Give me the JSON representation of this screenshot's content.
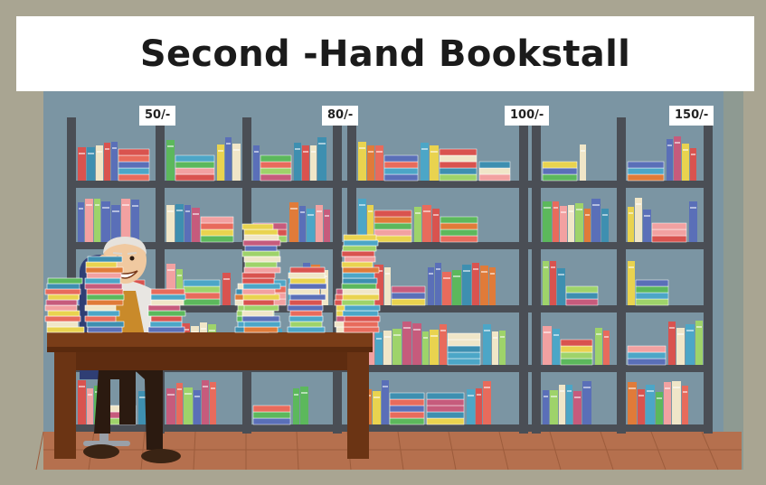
{
  "banner": {
    "title": "Second -Hand Bookstall"
  },
  "price_tags": [
    "50/-",
    "80/-",
    "100/-",
    "150/-"
  ],
  "colors": {
    "outer_frame": "#a9a592",
    "wall": "#7b95a3",
    "shelf_frame": "#4a4e55",
    "floor": "#b5704e",
    "desk": "#6b3414",
    "banner_bg": "#ffffff",
    "title_text": "#1b1b1b"
  },
  "scene": {
    "character": "old-bookseller",
    "objects": [
      "bookshelves",
      "book-stacks",
      "wooden-desk",
      "armchair"
    ]
  }
}
